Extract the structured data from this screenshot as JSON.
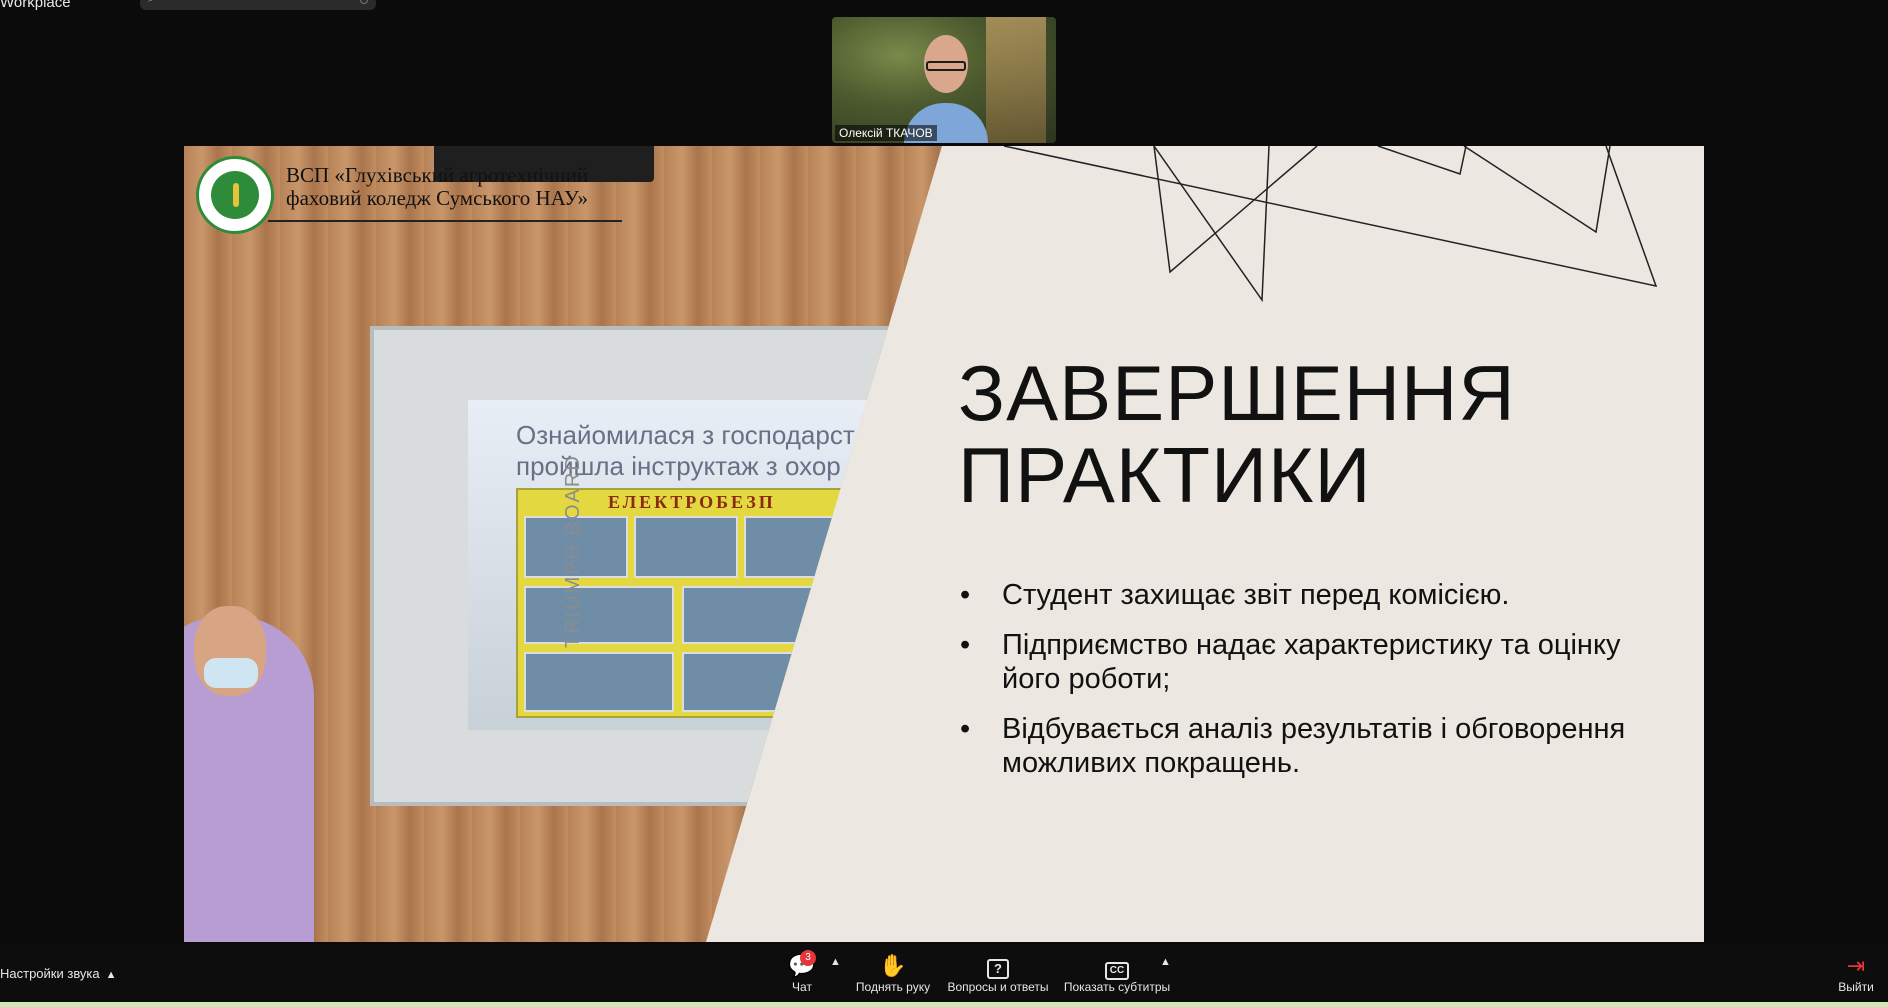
{
  "app": {
    "title": "Workplace"
  },
  "participant": {
    "name": "Олексій ТКАЧОВ"
  },
  "slide": {
    "org_line1": "ВСП «Глухівський агротехнічний",
    "org_line2": "фаховий коледж Сумського НАУ»",
    "heading_line1": "ЗАВЕРШЕННЯ",
    "heading_line2": "ПРАКТИКИ",
    "bullet_symbol": "•",
    "bullets": [
      "Студент захищає звіт перед комісією.",
      "Підприємство надає характеристику та оцінку його роботи;",
      "Відбувається аналіз результатів і обговорення можливих покращень."
    ],
    "photo_board_text_1": "Ознайомилася з господарст",
    "photo_board_text_2": "пройшла інструктаж з охор",
    "photo_poster_title": "ЕЛЕКТРОБЕЗП",
    "photo_board_brand": "TRIUMPH BOARD"
  },
  "toolbar": {
    "audio_settings": "Настройки звука",
    "chat": {
      "label": "Чат",
      "badge": "3",
      "icon": "chat-icon"
    },
    "raise_hand": {
      "label": "Поднять руку",
      "icon": "hand-icon"
    },
    "qa": {
      "label": "Вопросы и ответы",
      "icon": "question-icon",
      "glyph": "?"
    },
    "captions": {
      "label": "Показать субтитры",
      "icon": "cc-icon",
      "glyph": "CC"
    },
    "leave": {
      "label": "Выйти",
      "icon": "leave-icon"
    }
  }
}
